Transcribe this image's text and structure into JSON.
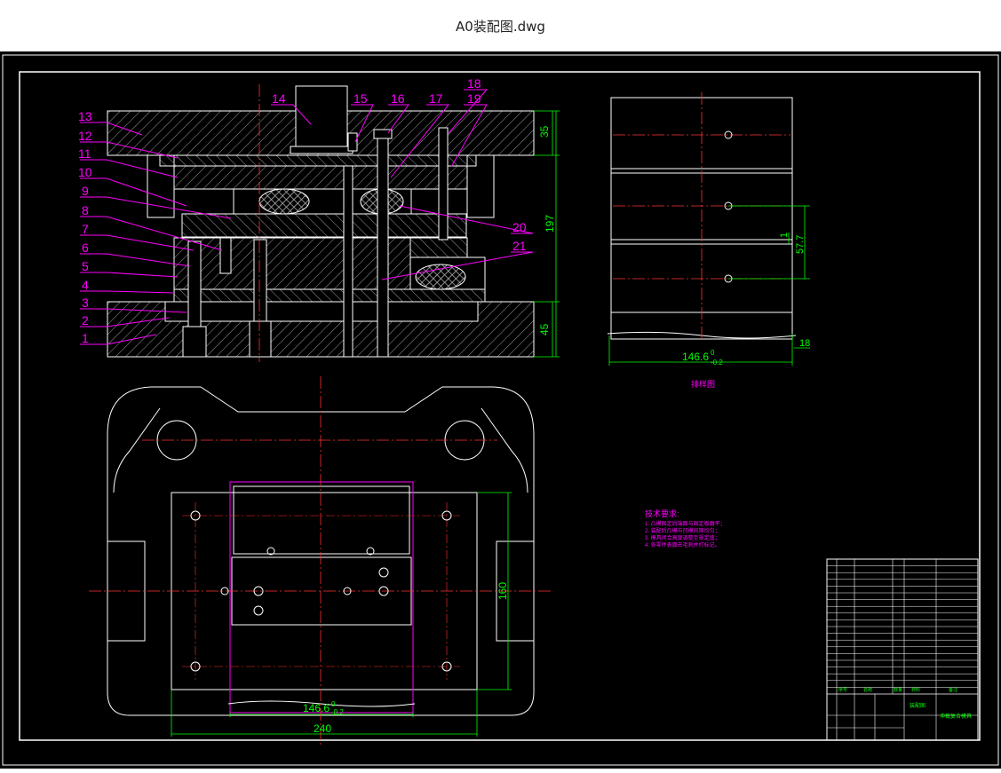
{
  "window": {
    "title": "A0装配图.dwg"
  },
  "colors": {
    "background": "#000000",
    "outline": "#ffffff",
    "leader": "#ff00ff",
    "dimension": "#00ff00",
    "centerline": "#ff3333",
    "title_text": "#00ff00"
  },
  "part_numbers": [
    "1",
    "2",
    "3",
    "4",
    "5",
    "6",
    "7",
    "8",
    "9",
    "10",
    "11",
    "12",
    "13",
    "14",
    "15",
    "16",
    "17",
    "18",
    "19",
    "20",
    "21"
  ],
  "dimensions": {
    "top_thickness": "35",
    "total_height": "197",
    "bottom_thickness": "45",
    "side_height": "57.7",
    "side_small": "18",
    "side_offset": "1",
    "strip_width": "146.6",
    "strip_tol_upper": "0",
    "strip_tol_lower": "-0.2",
    "plan_width": "240",
    "plan_height": "160",
    "plan_strip_width": "146.6",
    "plan_strip_tol_upper": "0",
    "plan_strip_tol_lower": "-0.2"
  },
  "side_view_caption": "排样图",
  "tech_requirements": {
    "heading": "技术要求:",
    "lines": [
      "1. 凸模固定后端面与固定板磨平；",
      "2. 装配后凸模与凹模间隙均匀；",
      "3. 模具闭合高度调整至规定值；",
      "4. 各零件表面去毛刺并打标记。"
    ]
  },
  "title_block": {
    "drawing_name": "装配图",
    "part_title": "冲裁复合模具",
    "header": [
      "序号",
      "名称",
      "数量",
      "材料",
      "备注"
    ]
  }
}
